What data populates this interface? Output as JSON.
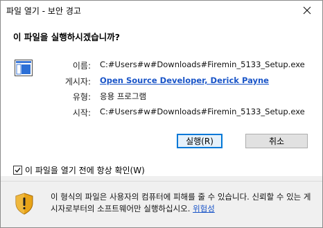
{
  "window": {
    "title": "파일 열기 - 보안 경고",
    "close_glyph": "✕"
  },
  "question": "이 파일을 실행하시겠습니까?",
  "file_info": {
    "name_label": "이름:",
    "name_value": "C:#Users#w#Downloads#Firemin_5133_Setup.exe",
    "publisher_label": "게시자:",
    "publisher_value": "Open Source Developer, Derick Payne",
    "type_label": "유형:",
    "type_value": "응용 프로그램",
    "from_label": "시작:",
    "from_value": "C:#Users#w#Downloads#Firemin_5133_Setup.exe"
  },
  "buttons": {
    "run_label": "실행(R)",
    "cancel_label": "취소"
  },
  "checkbox": {
    "label": "이 파일을 열기 전에 항상 확인(W)",
    "checked": true
  },
  "warning": {
    "text": "이 형식의 파일은 사용자의 컴퓨터에 피해를 줄 수 있습니다. 신뢰할 수 있는 게시자로부터의 소프트웨어만 실행하십시오.",
    "link_label": "위험성"
  },
  "icons": {
    "file": "application-file-icon",
    "shield": "security-shield-icon",
    "close": "close-icon"
  }
}
